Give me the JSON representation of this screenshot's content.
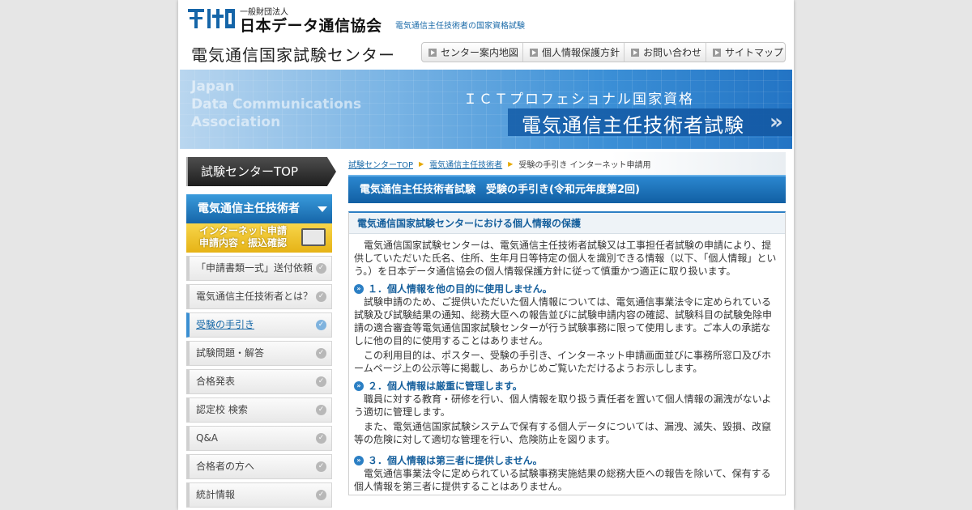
{
  "header": {
    "org_small": "一般財団法人",
    "org_name": "日本データ通信協会",
    "tagline": "電気通信主任技術者の国家資格試験",
    "site_title": "電気通信国家試験センター",
    "util_nav": [
      "センター案内地図",
      "個人情報保護方針",
      "お問い合わせ",
      "サイトマップ"
    ]
  },
  "banner": {
    "en_lines": [
      "Japan",
      "Data Communications",
      "Association"
    ],
    "sub": "ＩＣＴプロフェショナル国家資格",
    "main": "電気通信主任技術者試験"
  },
  "sidebar": {
    "top": "試験センターTOP",
    "category": "電気通信主任技術者",
    "apply_line1": "インターネット申請",
    "apply_line2": "申請内容・振込確認",
    "items": [
      {
        "label": "「申請書類一式」送付依頼"
      },
      {
        "label": "電気通信主任技術者とは？"
      },
      {
        "label": "受験の手引き"
      },
      {
        "label": "試験問題・解答"
      },
      {
        "label": "合格発表"
      },
      {
        "label": "認定校 検索"
      },
      {
        "label": "Q&A"
      },
      {
        "label": "合格者の方へ"
      },
      {
        "label": "統計情報"
      }
    ]
  },
  "breadcrumb": {
    "items": [
      "試験センターTOP",
      "電気通信主任技術者"
    ],
    "current": "受験の手引き インターネット申請用"
  },
  "main": {
    "heading": "電気通信主任技術者試験　受験の手引き(令和元年度第2回)",
    "section_title": "電気通信国家試験センターにおける個人情報の保護",
    "intro": "電気通信国家試験センターは、電気通信主任技術者試験又は工事担任者試験の申請により、提供していただいた氏名、住所、生年月日等特定の個人を識別できる情報（以下、「個人情報」という。）を日本データ通信協会の個人情報保護方針に従って慎重かつ適正に取り扱います。",
    "items": [
      {
        "title": "１．個人情報を他の目的に使用しません。",
        "paras": [
          "試験申請のため、ご提供いただいた個人情報については、電気通信事業法令に定められている試験及び試験結果の通知、総務大臣への報告並びに試験申請内容の確認、試験科目の試験免除申請の適合審査等電気通信国家試験センターが行う試験事務に限って使用します。ご本人の承諾なしに他の目的に使用することはありません。",
          "この利用目的は、ポスター、受験の手引き、インターネット申請画面並びに事務所窓口及びホームページ上の公示等に掲載し、あらかじめご覧いただけるようお示しします。"
        ]
      },
      {
        "title": "２．個人情報は厳重に管理します。",
        "paras": [
          "職員に対する教育・研修を行い、個人情報を取り扱う責任者を置いて個人情報の漏洩がないよう適切に管理します。",
          "また、電気通信国家試験システムで保有する個人データについては、漏洩、滅失、毀損、改竄等の危険に対して適切な管理を行い、危険防止を図ります。"
        ]
      },
      {
        "title": "３．個人情報は第三者に提供しません。",
        "paras": [
          "電気通信事業法令に定められている試験事務実施結果の総務大臣への報告を除いて、保有する個人情報を第三者に提供することはありません。"
        ]
      }
    ]
  },
  "colors": {
    "brand_blue": "#1565a8",
    "link_blue": "#1a6aa8",
    "apply_yellow": "#e6b316"
  }
}
